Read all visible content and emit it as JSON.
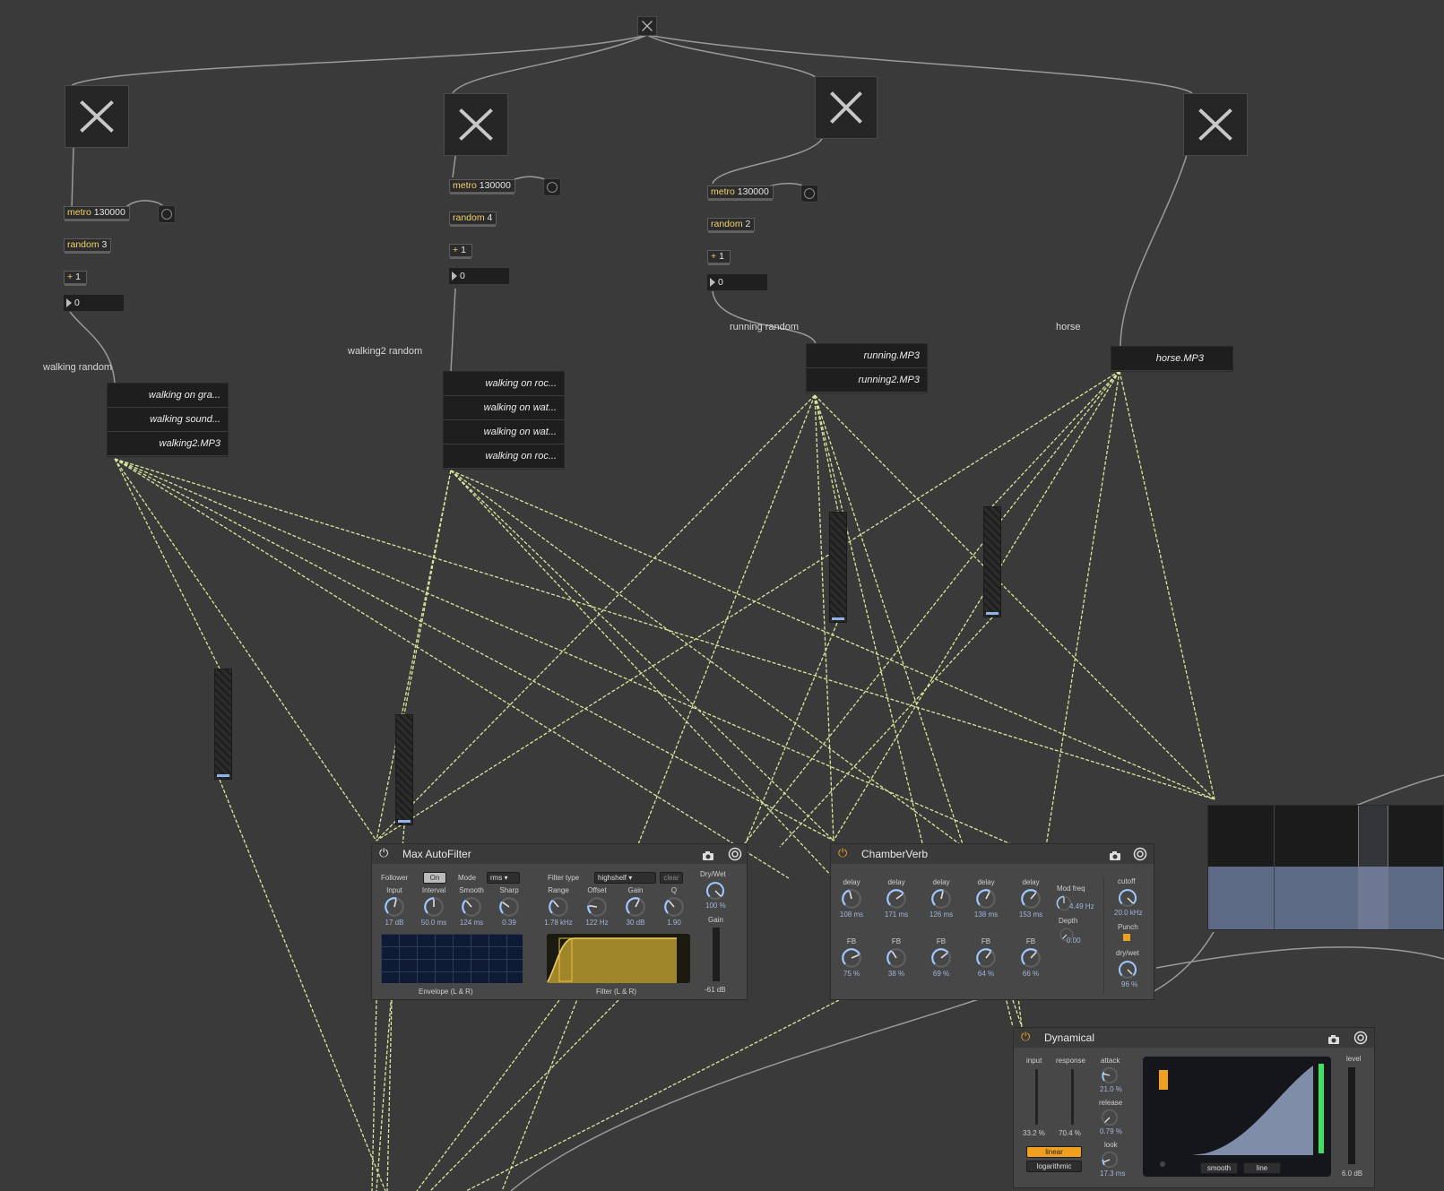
{
  "patch": {
    "labels": {
      "walking": "walking random",
      "walking2": "walking2 random",
      "running": "running random",
      "horse": "horse"
    },
    "chains": [
      {
        "metro": "metro",
        "metro_arg": "130000",
        "random": "random",
        "random_arg": "3",
        "plus": "+",
        "plus_arg": "1",
        "number": "0"
      },
      {
        "metro": "metro",
        "metro_arg": "130000",
        "random": "random",
        "random_arg": "4",
        "plus": "+",
        "plus_arg": "1",
        "number": "0"
      },
      {
        "metro": "metro",
        "metro_arg": "130000",
        "random": "random",
        "random_arg": "2",
        "plus": "+",
        "plus_arg": "1",
        "number": "0"
      }
    ],
    "players": {
      "walking": [
        "walking on gra...",
        "walking sound...",
        "walking2.MP3"
      ],
      "walking2": [
        "walking on roc...",
        "walking on wat...",
        "walking on wat...",
        "walking on roc..."
      ],
      "running": [
        "running.MP3",
        "running2.MP3"
      ],
      "horse": [
        "horse.MP3"
      ]
    }
  },
  "autofilter": {
    "title": "Max AutoFilter",
    "follower_label": "Follower",
    "follower_value": "On",
    "mode_label": "Mode",
    "mode_value": "rms",
    "filter_type_label": "Filter type",
    "filter_type_value": "highshelf",
    "clear": "clear",
    "drywet_label": "Dry/Wet",
    "drywet_value": "100 %",
    "gain_label": "Gain",
    "gain_value": "-61 dB",
    "knobs": [
      {
        "label": "Input",
        "value": "17 dB"
      },
      {
        "label": "Interval",
        "value": "50.0 ms"
      },
      {
        "label": "Smooth",
        "value": "124 ms"
      },
      {
        "label": "Sharp",
        "value": "0.39"
      },
      {
        "label": "Range",
        "value": "1.78 kHz"
      },
      {
        "label": "Offset",
        "value": "122 Hz"
      },
      {
        "label": "Gain",
        "value": "30 dB"
      },
      {
        "label": "Q",
        "value": "1.90"
      }
    ],
    "envelope_label": "Envelope (L & R)",
    "filter_label": "Filter (L & R)"
  },
  "chamberverb": {
    "title": "ChamberVerb",
    "delays": [
      {
        "label": "delay",
        "value": "108 ms"
      },
      {
        "label": "delay",
        "value": "171 ms"
      },
      {
        "label": "delay",
        "value": "126 ms"
      },
      {
        "label": "delay",
        "value": "138 ms"
      },
      {
        "label": "delay",
        "value": "153 ms"
      }
    ],
    "fbs": [
      {
        "label": "FB",
        "value": "75 %"
      },
      {
        "label": "FB",
        "value": "38 %"
      },
      {
        "label": "FB",
        "value": "69 %"
      },
      {
        "label": "FB",
        "value": "64 %"
      },
      {
        "label": "FB",
        "value": "66 %"
      }
    ],
    "modfreq_label": "Mod freq",
    "modfreq_value": "4.49 Hz",
    "depth_label": "Depth",
    "depth_value": "0.00",
    "cutoff_label": "cutoff",
    "cutoff_value": "20.0 kHz",
    "punch_label": "Punch",
    "drywet_label": "dry/wet",
    "drywet_value": "96 %"
  },
  "dynamical": {
    "title": "Dynamical",
    "input_label": "input",
    "input_value": "33.2 %",
    "response_label": "response",
    "response_value": "70.4 %",
    "attack_label": "attack",
    "attack_value": "21.0 %",
    "release_label": "release",
    "release_value": "0.79 %",
    "look_label": "look",
    "look_value": "17.3 ms",
    "level_label": "level",
    "level_value": "6.0 dB",
    "linear": "linear",
    "logarithmic": "logarithmic",
    "smooth": "smooth",
    "line": "line"
  },
  "colors": {
    "background": "#3a3a3a",
    "signal_cord": "#d7e89a",
    "accent": "#f0a020",
    "meter_green": "#3fe060"
  }
}
